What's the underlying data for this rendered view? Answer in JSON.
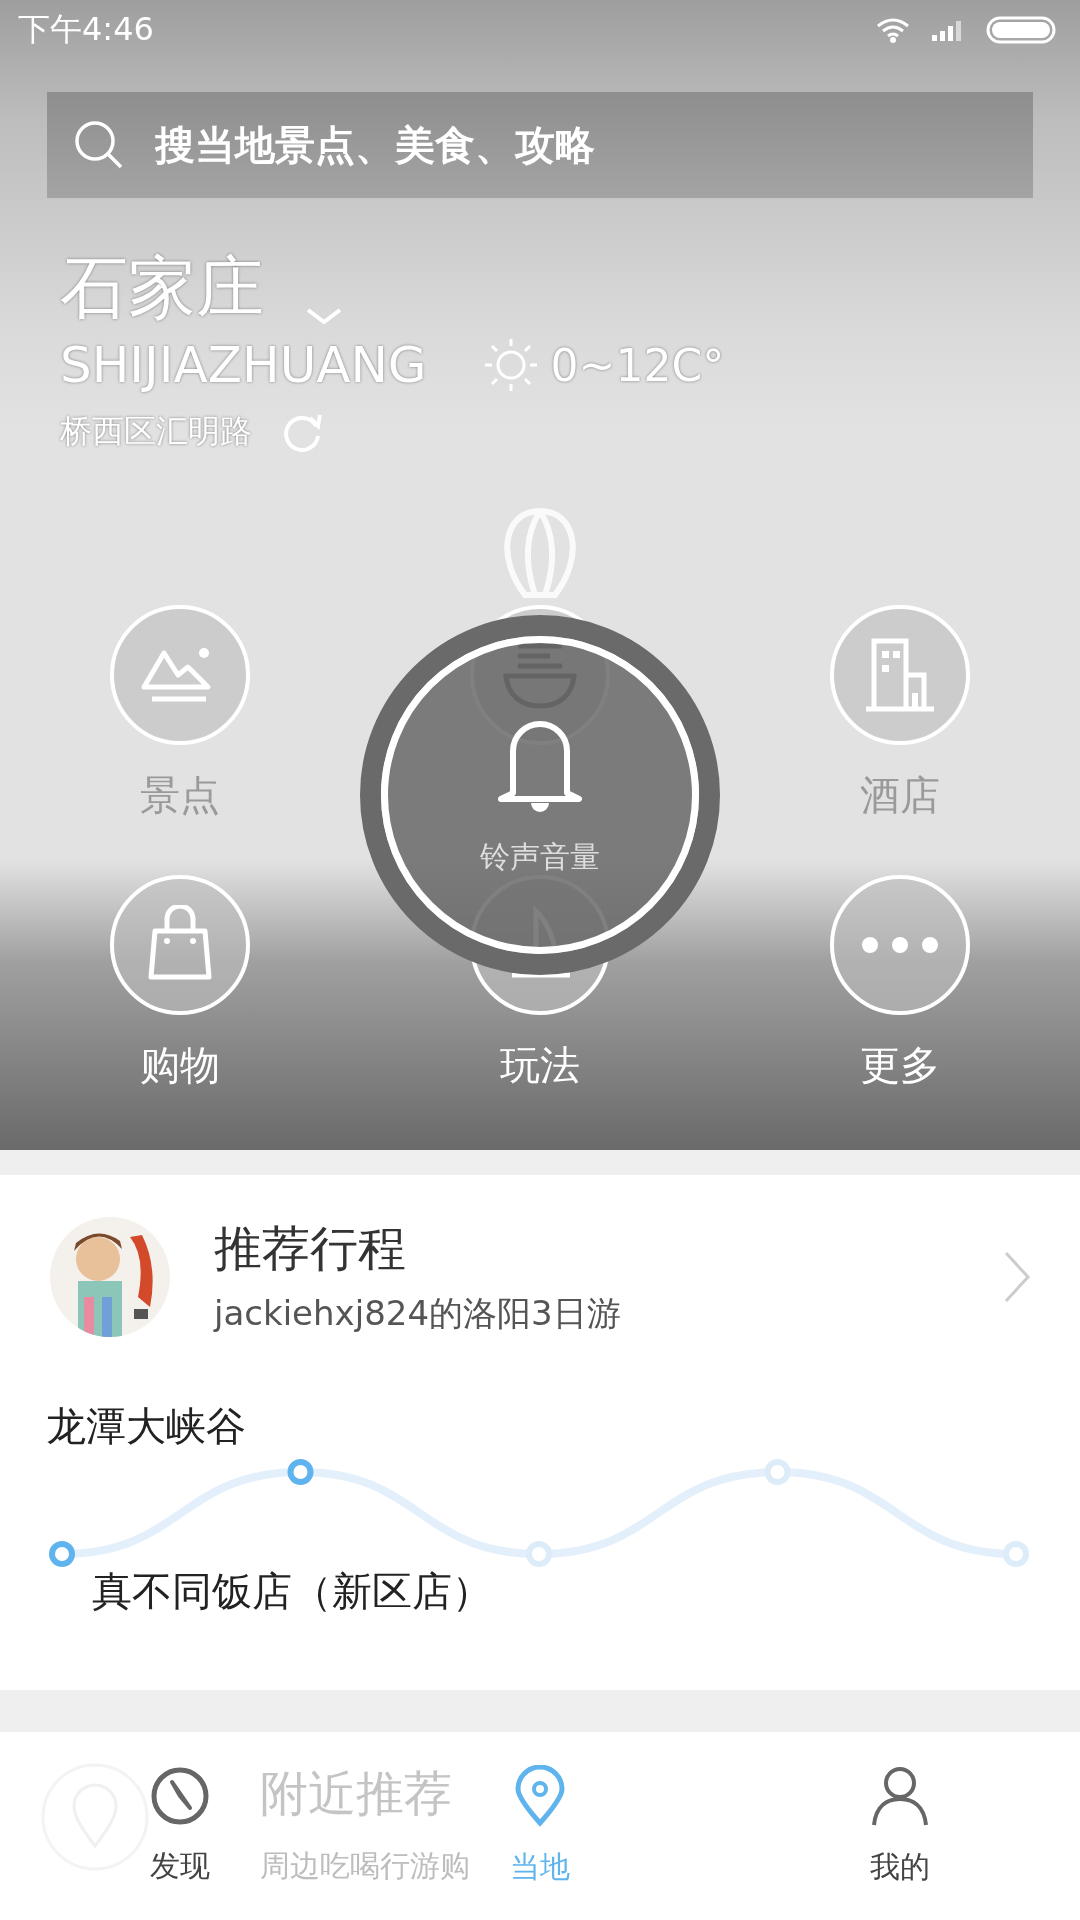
{
  "status_bar": {
    "time": "下午4:46"
  },
  "search": {
    "placeholder": "搜当地景点、美食、攻略"
  },
  "location": {
    "city": "石家庄",
    "pinyin": "SHIJIAZHUANG",
    "weather": "0~12C°",
    "address": "桥西区汇明路"
  },
  "categories": [
    {
      "kind": "scenery",
      "label": "景点"
    },
    {
      "kind": "food"
    },
    {
      "kind": "hotel",
      "label": "酒店"
    },
    {
      "kind": "shopping",
      "label": "购物"
    },
    {
      "kind": "play",
      "label": "玩法"
    },
    {
      "kind": "more",
      "label": "更多"
    }
  ],
  "volume_dialog": {
    "label": "铃声音量"
  },
  "itinerary": {
    "title": "推荐行程",
    "subtitle": "jackiehxj824的洛阳3日游",
    "start": "龙潭大峡谷",
    "end": "真不同饭店（新区店）",
    "stops": [
      {
        "visited": true
      },
      {
        "visited": true
      },
      {
        "visited": false
      },
      {
        "visited": false
      },
      {
        "visited": false
      }
    ]
  },
  "nearby": {
    "title": "附近推荐",
    "subtitle": "周边吃喝行游购"
  },
  "tab_bar": [
    {
      "kind": "compass",
      "label": "发现",
      "selected": false
    },
    {
      "kind": "pin",
      "label": "当地",
      "selected": true
    },
    {
      "kind": "person",
      "label": "我的",
      "selected": false
    }
  ]
}
